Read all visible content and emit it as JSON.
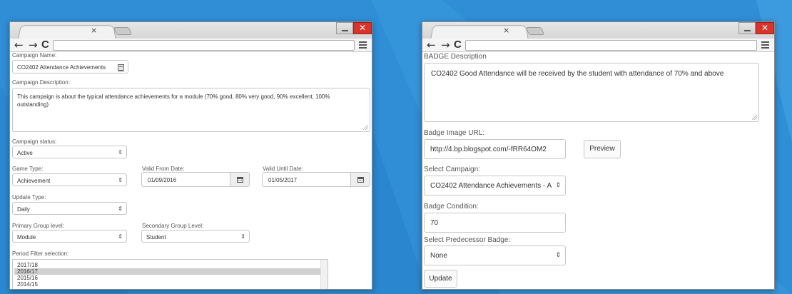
{
  "colors": {
    "background": "#2f8ed6",
    "close_button": "#d9342b",
    "selected_option": "#d0d0d0"
  },
  "browser": {
    "tab_close_glyph": "×",
    "back_glyph": "←",
    "forward_glyph": "→",
    "reload_glyph": "C",
    "close_glyph": "✕"
  },
  "left_window": {
    "campaign_name": {
      "label": "Campaign Name:",
      "value": "CO2402 Attendance Achievements"
    },
    "campaign_description": {
      "label": "Campaign Description:",
      "value": "This campaign is about the typical attendance achievements for a module (70% good, 80% very good, 90% excellent, 100% outstanding)"
    },
    "campaign_status": {
      "label": "Campaign status:",
      "value": "Active"
    },
    "game_type": {
      "label": "Game Type:",
      "value": "Achievement"
    },
    "valid_from": {
      "label": "Valid From Date:",
      "value": "01/09/2016"
    },
    "valid_until": {
      "label": "Valid Until Date:",
      "value": "01/05/2017"
    },
    "update_type": {
      "label": "Update Type:",
      "value": "Daily"
    },
    "primary_group": {
      "label": "Primary Group level:",
      "value": "Module"
    },
    "secondary_group": {
      "label": "Secondary Group Level:",
      "value": "Student"
    },
    "period_filter": {
      "label": "Period Filter selection:",
      "options": [
        "2017/18",
        "2016/17",
        "2015/16",
        "2014/15"
      ],
      "selected": "2016/17"
    },
    "select_arrow": "⇕"
  },
  "right_window": {
    "badge_description": {
      "label": "BADGE Description",
      "value": "CO2402 Good Attendance will be received by the student with attendance of 70% and above"
    },
    "badge_image_url": {
      "label": "Badge Image URL:",
      "value": "http://4.bp.blogspot.com/-fRR64OM2"
    },
    "preview_button": "Preview",
    "select_campaign": {
      "label": "Select Campaign:",
      "value": "CO2402 Attendance Achievements - A"
    },
    "badge_condition": {
      "label": "Badge Condition:",
      "value": "70"
    },
    "predecessor_badge": {
      "label": "Select Predecessor Badge:",
      "value": "None"
    },
    "update_button": "Update",
    "select_arrow": "⇕"
  }
}
